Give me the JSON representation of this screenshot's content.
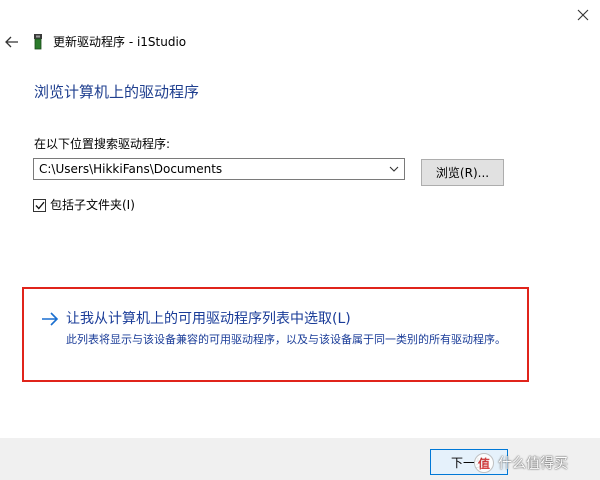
{
  "window": {
    "title": "更新驱动程序 - i1Studio",
    "close_glyph": "✕"
  },
  "page": {
    "title": "浏览计算机上的驱动程序"
  },
  "search": {
    "label": "在以下位置搜索驱动程序:",
    "path_value": "C:\\Users\\HikkiFans\\Documents",
    "browse_label": "浏览(R)...",
    "include_subfolders_label": "包括子文件夹(I)",
    "include_subfolders_checked": true
  },
  "pick_option": {
    "title": "让我从计算机上的可用驱动程序列表中选取(L)",
    "description": "此列表将显示与该设备兼容的可用驱动程序，以及与该设备属于同一类别的所有驱动程序。"
  },
  "footer": {
    "next_label": "下一步"
  },
  "watermark": {
    "logo_glyph": "值",
    "text": "什么值得买"
  },
  "colors": {
    "title_blue": "#1f3f8f",
    "link_blue": "#1a3c98",
    "highlight_red": "#e0241b",
    "footer_bg": "#f0f0f0"
  },
  "icons": {
    "back": "back-arrow-icon",
    "device": "usb-device-icon",
    "close": "close-icon",
    "dropdown": "chevron-down-icon",
    "check": "checkmark-icon",
    "link_arrow": "arrow-right-icon"
  }
}
